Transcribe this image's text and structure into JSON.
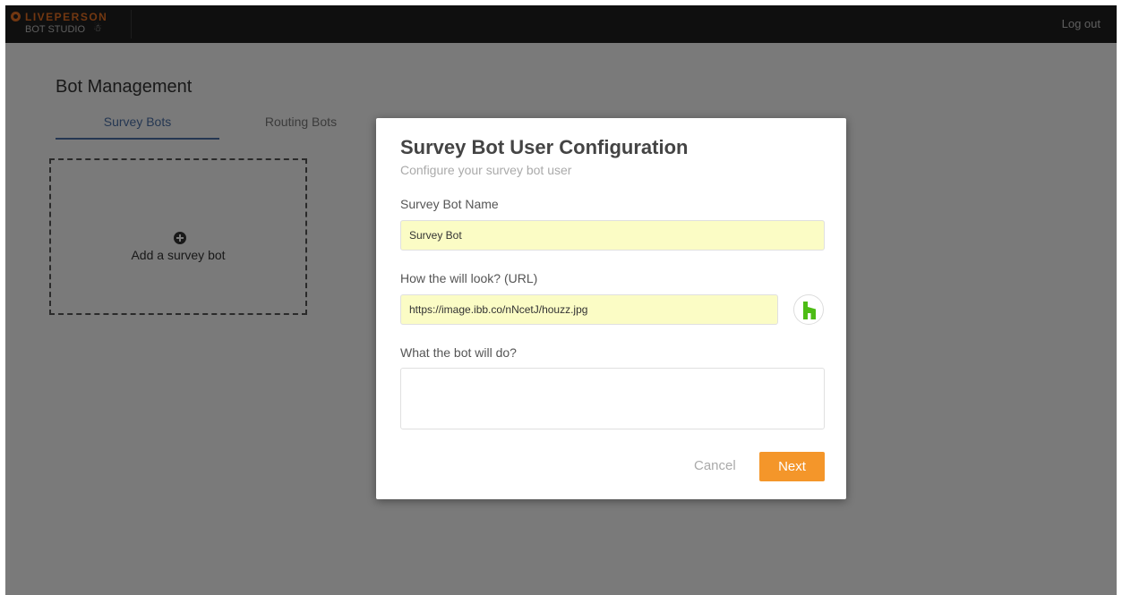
{
  "header": {
    "brand": "LIVEPERSON",
    "product": "BOT STUDIO",
    "logout_label": "Log out"
  },
  "page": {
    "title": "Bot Management",
    "tabs": [
      {
        "label": "Survey Bots",
        "active": true
      },
      {
        "label": "Routing Bots",
        "active": false
      }
    ],
    "add_card_label": "Add a survey bot",
    "background_fragment": "r"
  },
  "modal": {
    "title": "Survey Bot User Configuration",
    "subtitle": "Configure your survey bot user",
    "name_label": "Survey Bot Name",
    "name_value": "Survey Bot",
    "url_label": "How the will look? (URL)",
    "url_value": "https://image.ibb.co/nNcetJ/houzz.jpg",
    "task_label": "What the bot will do?",
    "task_value": "",
    "cancel_label": "Cancel",
    "next_label": "Next"
  },
  "colors": {
    "accent": "#f4962a",
    "tab_active": "#4a6fa5",
    "input_autofill": "#fbfcc5",
    "brand_orange": "#e46f22",
    "houzz_green": "#4dbc15"
  },
  "icons": {
    "brand": "liveperson-logo-icon",
    "add": "plus-circle-icon",
    "preview": "houzz-icon"
  }
}
